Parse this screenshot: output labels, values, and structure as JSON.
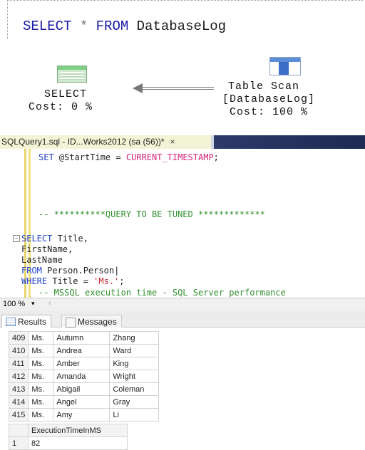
{
  "top_query": {
    "select": "SELECT",
    "star": "*",
    "from": "FROM",
    "table": "DatabaseLog"
  },
  "plan": {
    "select_node": {
      "title": "SELECT",
      "cost": "Cost: 0 %"
    },
    "scan_node": {
      "title": "Table Scan",
      "object": "[DatabaseLog]",
      "cost": "Cost: 100 %"
    }
  },
  "tab": {
    "title": "SQLQuery1.sql - ID...Works2012 (sa (56))*",
    "close": "×"
  },
  "editor": {
    "line1": {
      "set": "SET",
      "var": " @StartTime = ",
      "fn": "CURRENT_TIMESTAMP",
      "end": ";"
    },
    "line2": "-- **********QUERY TO BE TUNED *************",
    "line3": {
      "kw": "SELECT",
      "rest": " Title,"
    },
    "line4": "FirstName,",
    "line5": "LastName",
    "line6": {
      "kw": "FROM",
      "rest": " Person.Person"
    },
    "line7": {
      "kw": "WHERE",
      "rest": " Title = ",
      "str": "'Ms.'",
      "end": ";"
    },
    "line8": "-- MSSQL execution time - SQL Server performance"
  },
  "zoom": {
    "level": "100 %"
  },
  "results_tabs": {
    "results": "Results",
    "messages": "Messages"
  },
  "results1": {
    "rows": [
      [
        "409",
        "Ms.",
        "Autumn",
        "Zhang"
      ],
      [
        "410",
        "Ms.",
        "Andrea",
        "Ward"
      ],
      [
        "411",
        "Ms.",
        "Amber",
        "King"
      ],
      [
        "412",
        "Ms.",
        "Amanda",
        "Wright"
      ],
      [
        "413",
        "Ms.",
        "Abigail",
        "Coleman"
      ],
      [
        "414",
        "Ms.",
        "Angel",
        "Gray"
      ],
      [
        "415",
        "Ms.",
        "Amy",
        "Li"
      ]
    ]
  },
  "results2": {
    "header": "ExecutionTimeInMS",
    "rows": [
      [
        "1",
        "82"
      ]
    ]
  },
  "colors": {
    "keyword": "#1e3fd1",
    "function": "#d4237a",
    "comment": "#2f8f2f",
    "string": "#c4262e"
  }
}
